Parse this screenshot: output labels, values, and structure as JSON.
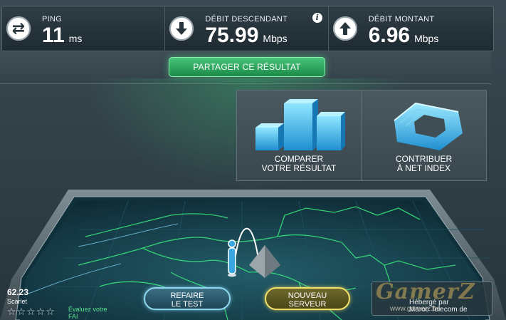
{
  "stats": {
    "ping": {
      "label": "PING",
      "value": "11",
      "unit": "ms",
      "icon": "ping-arrows-icon"
    },
    "download": {
      "label": "DÉBIT DESCENDANT",
      "value": "75.99",
      "unit": "Mbps",
      "icon": "download-arrow-icon",
      "info": "i"
    },
    "upload": {
      "label": "DÉBIT MONTANT",
      "value": "6.96",
      "unit": "Mbps",
      "icon": "upload-arrow-icon"
    }
  },
  "share": {
    "label": "PARTAGER CE RÉSULTAT"
  },
  "cards": [
    {
      "label": "COMPARER\nVOTRE RÉSULTAT",
      "icon": "bar-chart-3d-icon"
    },
    {
      "label": "CONTRIBUER\nÀ NET INDEX",
      "icon": "net-index-ring-icon"
    }
  ],
  "isp": {
    "rate": "62.23",
    "name": "Scarlet",
    "stars": [
      "☆",
      "☆",
      "☆",
      "☆",
      "☆"
    ],
    "rate_link": "Évaluez votre\nFAI"
  },
  "buttons": {
    "retest": "REFAIRE\nLE TEST",
    "new_server": "NOUVEAU\nSERVEUR"
  },
  "host": {
    "label": "Hébergé par\nMaroc Telecom de"
  },
  "watermark": {
    "text": "GamerZ",
    "sub": "www.gamerz.be"
  },
  "colors": {
    "accent_green": "#46c47a",
    "retest_border": "#8fd7ee",
    "newserver_border": "#f2e06a",
    "map_lines": "#38e07a"
  }
}
